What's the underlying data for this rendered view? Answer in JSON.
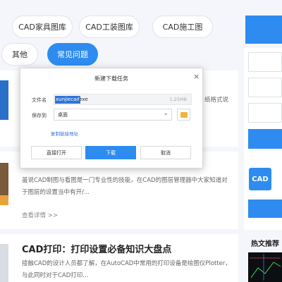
{
  "tabs": [
    {
      "label": "CAD家具图库",
      "active": false
    },
    {
      "label": "CAD工装图库",
      "active": false
    },
    {
      "label": "CAD施工图",
      "active": false
    },
    {
      "label": "其他",
      "active": false
    },
    {
      "label": "常见问题",
      "active": true
    }
  ],
  "articles": {
    "first_snippet_fragment": "纸格式说",
    "second_snippet": "虽说CAD制图与看图是一门专业性的技能，在CAD的图层管理器中大家知道对于图层的设置当中有开/...",
    "second_more": "查看详情 >>",
    "third_title": "CAD打印：打印设置必备知识大盘点",
    "third_snippet": "接触CAD的设计人员都了解，在AutoCAD中常用的打印设备是绘图仪Plotter，与此同时对于CAD打印..."
  },
  "sidebar": {
    "hot_title": "热文推荐",
    "cad_logo_text": "CAD"
  },
  "dialog": {
    "title": "新建下载任务",
    "close_glyph": "×",
    "filename_label": "文件名",
    "filename_selected": "xunjiecad",
    "filename_ext": ".exe",
    "file_size": "1.25MB",
    "saveto_label": "保存到",
    "saveto_value": "桌面",
    "copy_link": "复制链接地址",
    "open_button": "直接打开",
    "download_button": "下载",
    "cancel_button": "取消"
  },
  "colors": {
    "accent": "#2e8cf0",
    "selection": "#2e74d6"
  }
}
